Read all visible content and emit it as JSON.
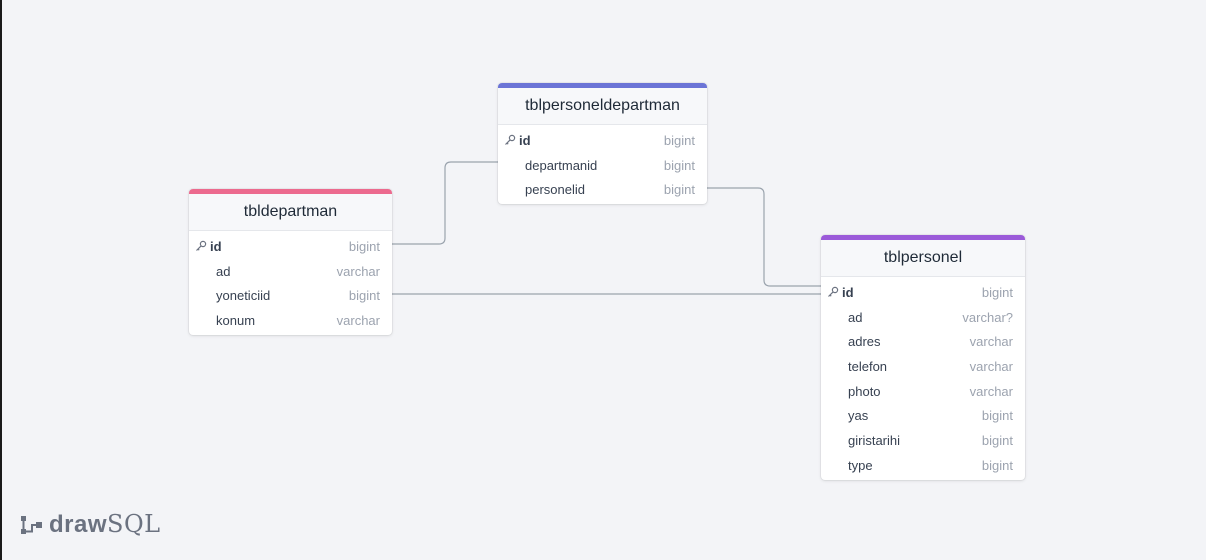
{
  "tables": {
    "tbldepartman": {
      "title": "tbldepartman",
      "color": "#ec6a8e",
      "columns": [
        {
          "name": "id",
          "type": "bigint",
          "pk": true
        },
        {
          "name": "ad",
          "type": "varchar"
        },
        {
          "name": "yoneticiid",
          "type": "bigint"
        },
        {
          "name": "konum",
          "type": "varchar"
        }
      ]
    },
    "tblpersoneldepartman": {
      "title": "tblpersoneldepartman",
      "color": "#6b74d6",
      "columns": [
        {
          "name": "id",
          "type": "bigint",
          "pk": true
        },
        {
          "name": "departmanid",
          "type": "bigint"
        },
        {
          "name": "personelid",
          "type": "bigint"
        }
      ]
    },
    "tblpersonel": {
      "title": "tblpersonel",
      "color": "#9b5ad9",
      "columns": [
        {
          "name": "id",
          "type": "bigint",
          "pk": true
        },
        {
          "name": "ad",
          "type": "varchar?"
        },
        {
          "name": "adres",
          "type": "varchar"
        },
        {
          "name": "telefon",
          "type": "varchar"
        },
        {
          "name": "photo",
          "type": "varchar"
        },
        {
          "name": "yas",
          "type": "bigint"
        },
        {
          "name": "giristarihi",
          "type": "bigint"
        },
        {
          "name": "type",
          "type": "bigint"
        }
      ]
    }
  },
  "logo": {
    "draw": "draw",
    "sql": "SQL"
  },
  "icons": {
    "primary_key": "key-icon",
    "logo_mark": "drawsql-logo-icon"
  }
}
